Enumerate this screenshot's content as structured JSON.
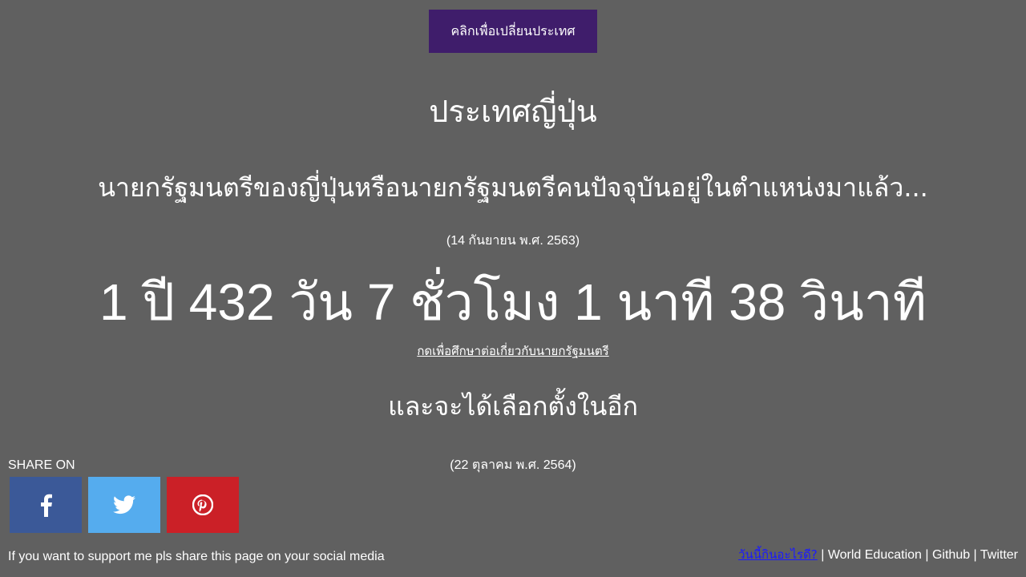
{
  "header": {
    "switch_country_label": "คลิกเพื่อเปลี่ยนประเทศ"
  },
  "main": {
    "country_title": "ประเทศญี่ปุ่น",
    "pm_heading": "นายกรัฐมนตรีของญี่ปุ่นหรือนายกรัฐมนตรีคนปัจจุบันอยู่ในตำแหน่งมาแล้ว...",
    "pm_start_date": "(14 กันยายน พ.ศ. 2563)",
    "duration": "1 ปี 432 วัน 7 ชั่วโมง 1 นาที 38 วินาที",
    "learn_more_link": "กดเพื่อศึกษาต่อเกี่ยวกับนายกรัฐมนตรี",
    "election_heading": "และจะได้เลือกตั้งในอีก",
    "election_date": "(22 ตุลาคม พ.ศ. 2564)"
  },
  "share": {
    "label": "SHARE ON",
    "buttons": [
      {
        "network": "facebook",
        "icon": "facebook-icon",
        "color": "#3b5998"
      },
      {
        "network": "twitter",
        "icon": "twitter-icon",
        "color": "#55acee"
      },
      {
        "network": "pinterest",
        "icon": "pinterest-icon",
        "color": "#cb2027"
      }
    ]
  },
  "footer": {
    "support_text": "If you want to support me pls share this page on your social media",
    "links": {
      "today": "วันนี้กินอะไรดี?",
      "separator": " | ",
      "world_education": "World Education",
      "github": "Github",
      "twitter": "Twitter"
    }
  },
  "colors": {
    "background": "#606060",
    "button_purple": "#3f1d6b"
  }
}
